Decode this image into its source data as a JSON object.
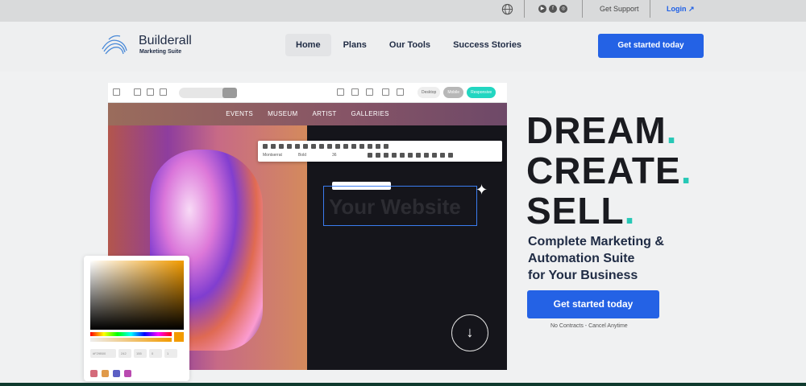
{
  "topbar": {
    "support": "Get Support",
    "login": "Login ↗",
    "globe_icon": "globe-icon",
    "social_icons": [
      "youtube-icon",
      "facebook-icon",
      "instagram-icon"
    ]
  },
  "header": {
    "brand": "Builderall",
    "brand_sub": "Marketing Suite",
    "nav": [
      "Home",
      "Plans",
      "Our Tools",
      "Success Stories"
    ],
    "active_nav": "Home",
    "cta": "Get started today"
  },
  "editor": {
    "segments": [
      "Desktop",
      "Mobile",
      "Responsive"
    ],
    "menu": [
      "EVENTS",
      "MUSEUM",
      "ARTIST",
      "GALLERIES"
    ],
    "headline_text": "Your Website",
    "rte_font": "Montserrat",
    "rte_weight": "Bold",
    "rte_size": "36",
    "picker": {
      "hex": "#F29B00",
      "fields": [
        "#F29B00",
        "242",
        "155",
        "0",
        "1"
      ],
      "swatches": [
        "#d46a7a",
        "#e09a4a",
        "#5c5fc4",
        "#b94ab0"
      ]
    }
  },
  "hero": {
    "line1": "DREAM",
    "line2": "CREATE",
    "line3": "SELL",
    "dot": ".",
    "sub1": "Complete Marketing &",
    "sub2": "Automation Suite",
    "sub3": "for Your Business",
    "cta": "Get started today",
    "note": "No Contracts - Cancel Anytime"
  },
  "colors": {
    "accent": "#2462e5",
    "teal": "#27c8b6",
    "dark": "#1a1b20"
  }
}
